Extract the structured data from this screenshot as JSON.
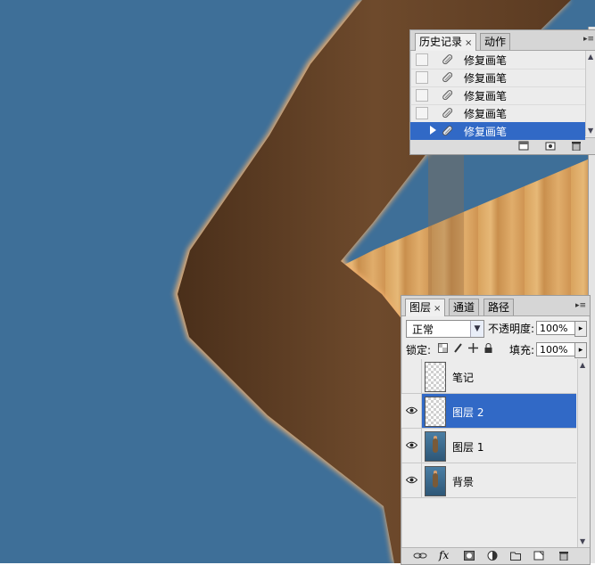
{
  "history_panel": {
    "tabs": [
      {
        "label": "历史记录",
        "active": true,
        "has_close": true
      },
      {
        "label": "动作",
        "active": false,
        "has_close": false
      }
    ],
    "close_glyph": "×",
    "steps": [
      {
        "label": "修复画笔",
        "selected": false,
        "icon": "healing-brush-icon"
      },
      {
        "label": "修复画笔",
        "selected": false,
        "icon": "healing-brush-icon"
      },
      {
        "label": "修复画笔",
        "selected": false,
        "icon": "healing-brush-icon"
      },
      {
        "label": "修复画笔",
        "selected": false,
        "icon": "healing-brush-icon"
      },
      {
        "label": "修复画笔",
        "selected": true,
        "icon": "healing-brush-icon"
      }
    ],
    "footer_icons": [
      "new-document-from-state-icon",
      "create-snapshot-icon",
      "trash-icon"
    ]
  },
  "layers_panel": {
    "tabs": [
      {
        "label": "图层",
        "active": true,
        "has_close": true
      },
      {
        "label": "通道",
        "active": false,
        "has_close": false
      },
      {
        "label": "路径",
        "active": false,
        "has_close": false
      }
    ],
    "blend_mode": "正常",
    "opacity_label": "不透明度:",
    "opacity_value": "100%",
    "lock_label": "锁定:",
    "fill_label": "填充:",
    "fill_value": "100%",
    "layers": [
      {
        "name": "笔记",
        "visible": false,
        "selected": false,
        "thumb": "transparent"
      },
      {
        "name": "图层 2",
        "visible": true,
        "selected": true,
        "thumb": "transparent"
      },
      {
        "name": "图层 1",
        "visible": true,
        "selected": false,
        "thumb": "photo"
      },
      {
        "name": "背景",
        "visible": true,
        "selected": false,
        "thumb": "photo"
      }
    ],
    "footer_icons": [
      "link-layers-icon",
      "layer-style-fx-icon",
      "layer-mask-icon",
      "adjustment-layer-icon",
      "new-group-icon",
      "new-layer-icon",
      "trash-icon"
    ],
    "fx_text": "fx"
  },
  "colors": {
    "canvas_background": "#3e6f98",
    "selection_blue": "#3169c6",
    "panel_gray": "#ececec"
  }
}
